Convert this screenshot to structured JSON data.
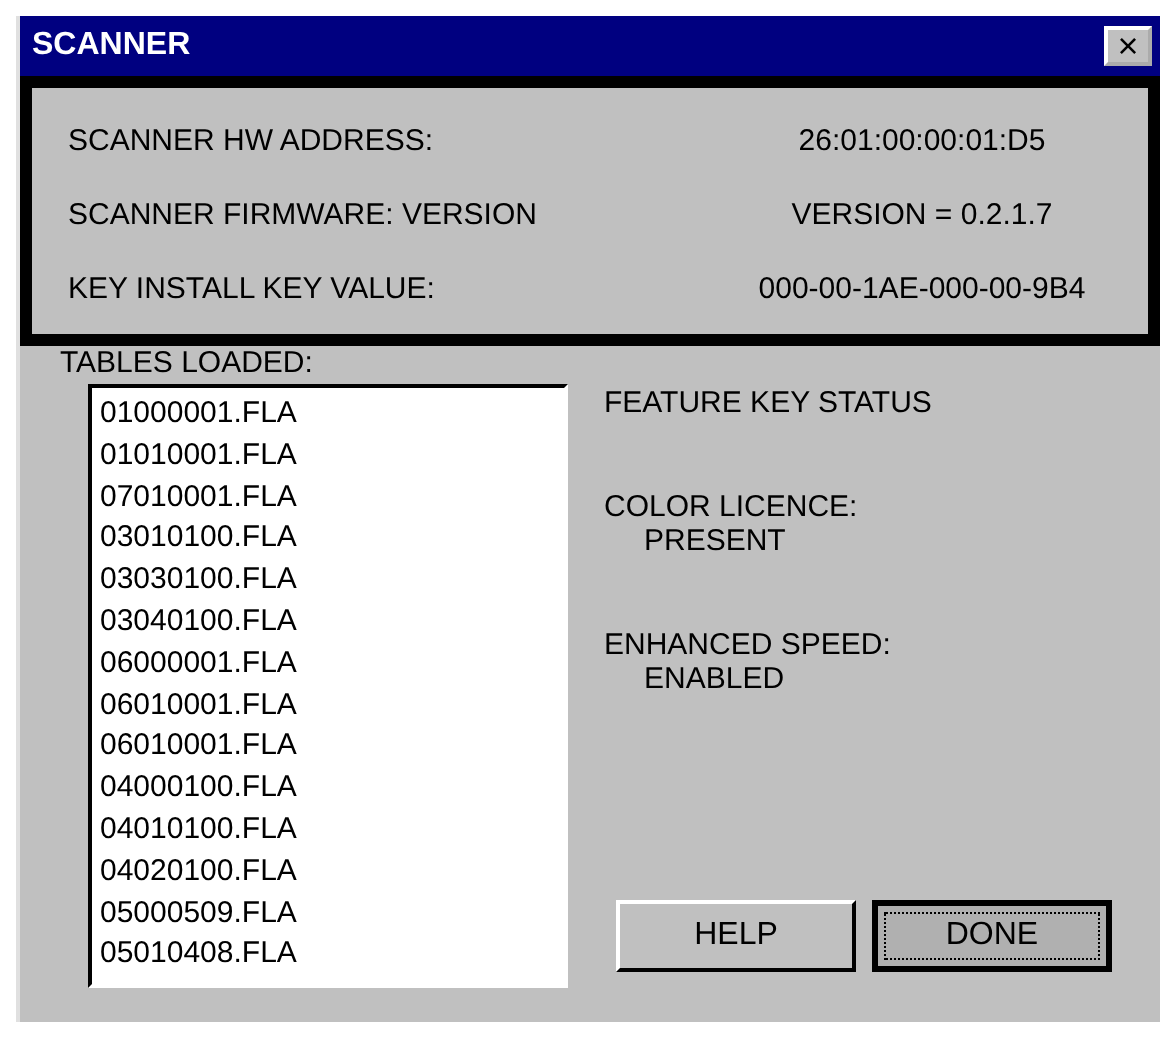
{
  "window": {
    "title": "SCANNER",
    "close": "×"
  },
  "info": [
    {
      "label": "SCANNER HW ADDRESS:",
      "value": "26:01:00:00:01:D5"
    },
    {
      "label": "SCANNER FIRMWARE: VERSION",
      "value": "VERSION  = 0.2.1.7"
    },
    {
      "label": "KEY INSTALL KEY VALUE:",
      "value": "000-00-1AE-000-00-9B4"
    }
  ],
  "tables": {
    "label": "TABLES LOADED:",
    "items": [
      "01000001.FLA",
      "01010001.FLA",
      "07010001.FLA",
      "03010100.FLA",
      "03030100.FLA",
      "03040100.FLA",
      "06000001.FLA",
      "06010001.FLA",
      "06010001.FLA",
      "04000100.FLA",
      "04010100.FLA",
      "04020100.FLA",
      "05000509.FLA",
      "05010408.FLA"
    ]
  },
  "feature_keys": {
    "title": "FEATURE KEY STATUS",
    "items": [
      {
        "label": "COLOR LICENCE:",
        "value": "PRESENT"
      },
      {
        "label": "ENHANCED SPEED:",
        "value": "ENABLED"
      }
    ]
  },
  "buttons": [
    {
      "label": "HELP",
      "focused": false
    },
    {
      "label": "DONE",
      "focused": true
    }
  ]
}
